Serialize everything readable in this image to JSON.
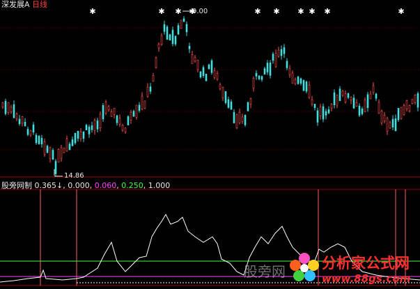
{
  "header": {
    "stock_name": "深发展A",
    "period": "日线"
  },
  "price_annotations": {
    "high": "9.00",
    "low": "14.86"
  },
  "indicator": {
    "name": "股旁网制",
    "values": [
      {
        "text": "0.365",
        "color": "#e6e6e6"
      },
      {
        "text": "0.000",
        "color": "#e6e6e6"
      },
      {
        "text": "0.060",
        "color": "#ff40ff"
      },
      {
        "text": "0.250",
        "color": "#40ff40"
      },
      {
        "text": "1.000",
        "color": "#e6e6e6"
      }
    ]
  },
  "watermark": {
    "text": "股旁网",
    "logo_cn": "分析家公式网",
    "logo_url": "www.88gs.com"
  },
  "colors": {
    "up": "#ff5050",
    "down": "#40e0e0",
    "grid": "#a00000",
    "indicator_line": "#ffffff",
    "level_green": "#40ff40",
    "level_magenta": "#ff40ff"
  }
}
